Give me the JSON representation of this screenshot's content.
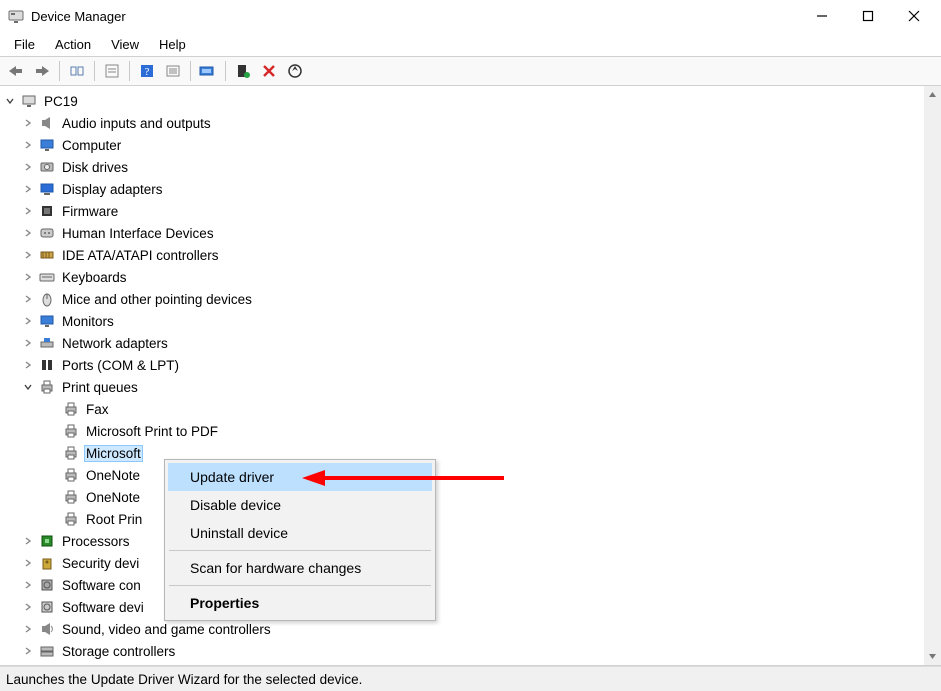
{
  "window": {
    "title": "Device Manager"
  },
  "menu": {
    "items": [
      "File",
      "Action",
      "View",
      "Help"
    ]
  },
  "tree": {
    "root": "PC19",
    "categories": [
      {
        "label": "Audio inputs and outputs",
        "expanded": false,
        "icon": "speaker"
      },
      {
        "label": "Computer",
        "expanded": false,
        "icon": "monitor"
      },
      {
        "label": "Disk drives",
        "expanded": false,
        "icon": "disk"
      },
      {
        "label": "Display adapters",
        "expanded": false,
        "icon": "display"
      },
      {
        "label": "Firmware",
        "expanded": false,
        "icon": "chip"
      },
      {
        "label": "Human Interface Devices",
        "expanded": false,
        "icon": "hid"
      },
      {
        "label": "IDE ATA/ATAPI controllers",
        "expanded": false,
        "icon": "ide"
      },
      {
        "label": "Keyboards",
        "expanded": false,
        "icon": "keyboard"
      },
      {
        "label": "Mice and other pointing devices",
        "expanded": false,
        "icon": "mouse"
      },
      {
        "label": "Monitors",
        "expanded": false,
        "icon": "monitorcat"
      },
      {
        "label": "Network adapters",
        "expanded": false,
        "icon": "network"
      },
      {
        "label": "Ports (COM & LPT)",
        "expanded": false,
        "icon": "ports"
      },
      {
        "label": "Print queues",
        "expanded": true,
        "icon": "printer",
        "children": [
          {
            "label": "Fax",
            "selected": false
          },
          {
            "label": "Microsoft Print to PDF",
            "selected": false
          },
          {
            "label": "Microsoft XPS Document Writer",
            "selected": true,
            "truncated_display": "Microsoft "
          },
          {
            "label": "OneNote",
            "truncated_display": "OneNote"
          },
          {
            "label": "OneNote",
            "truncated_display": "OneNote"
          },
          {
            "label": "Root Printer",
            "truncated_display": "Root Prin"
          }
        ]
      },
      {
        "label": "Processors",
        "expanded": false,
        "icon": "cpu"
      },
      {
        "label": "Security devices",
        "expanded": false,
        "icon": "security",
        "truncated_display": "Security devi"
      },
      {
        "label": "Software components",
        "expanded": false,
        "icon": "swcomp",
        "truncated_display": "Software con"
      },
      {
        "label": "Software devices",
        "expanded": false,
        "icon": "swdev",
        "truncated_display": "Software devi"
      },
      {
        "label": "Sound, video and game controllers",
        "expanded": false,
        "icon": "sound"
      },
      {
        "label": "Storage controllers",
        "expanded": false,
        "icon": "storage",
        "truncated_display": "Storage controllers"
      }
    ]
  },
  "context_menu": {
    "items": [
      {
        "label": "Update driver",
        "highlighted": true
      },
      {
        "label": "Disable device"
      },
      {
        "label": "Uninstall device"
      },
      {
        "separator": true
      },
      {
        "label": "Scan for hardware changes"
      },
      {
        "separator": true
      },
      {
        "label": "Properties",
        "bold": true
      }
    ]
  },
  "statusbar": {
    "text": "Launches the Update Driver Wizard for the selected device."
  },
  "toolbar_icons": [
    "back",
    "forward",
    "sep",
    "show-hidden",
    "sep",
    "properties-sheet",
    "sep",
    "help",
    "action-list",
    "sep",
    "update-driver",
    "sep",
    "enable-device",
    "uninstall-device",
    "scan-hardware"
  ]
}
